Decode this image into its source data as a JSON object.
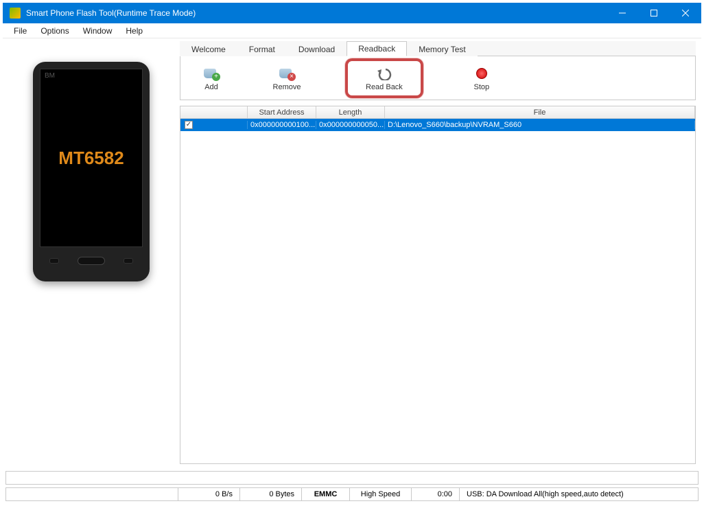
{
  "window": {
    "title": "Smart Phone Flash Tool(Runtime Trace Mode)"
  },
  "menu": {
    "file": "File",
    "options": "Options",
    "window": "Window",
    "help": "Help"
  },
  "phone": {
    "brand": "BM",
    "chip": "MT6582"
  },
  "tabs": {
    "welcome": "Welcome",
    "format": "Format",
    "download": "Download",
    "readback": "Readback",
    "memory_test": "Memory Test",
    "active": "readback"
  },
  "toolbar": {
    "add": "Add",
    "remove": "Remove",
    "readback": "Read Back",
    "stop": "Stop"
  },
  "table": {
    "headers": {
      "checkbox": "",
      "start_address": "Start Address",
      "length": "Length",
      "file": "File"
    },
    "rows": [
      {
        "checked": true,
        "start_address": "0x000000000100...",
        "length": "0x000000000050...",
        "file": "D:\\Lenovo_S660\\backup\\NVRAM_S660"
      }
    ]
  },
  "status": {
    "speed": "0 B/s",
    "bytes": "0 Bytes",
    "storage": "EMMC",
    "mode": "High Speed",
    "time": "0:00",
    "usb": "USB: DA Download All(high speed,auto detect)"
  }
}
